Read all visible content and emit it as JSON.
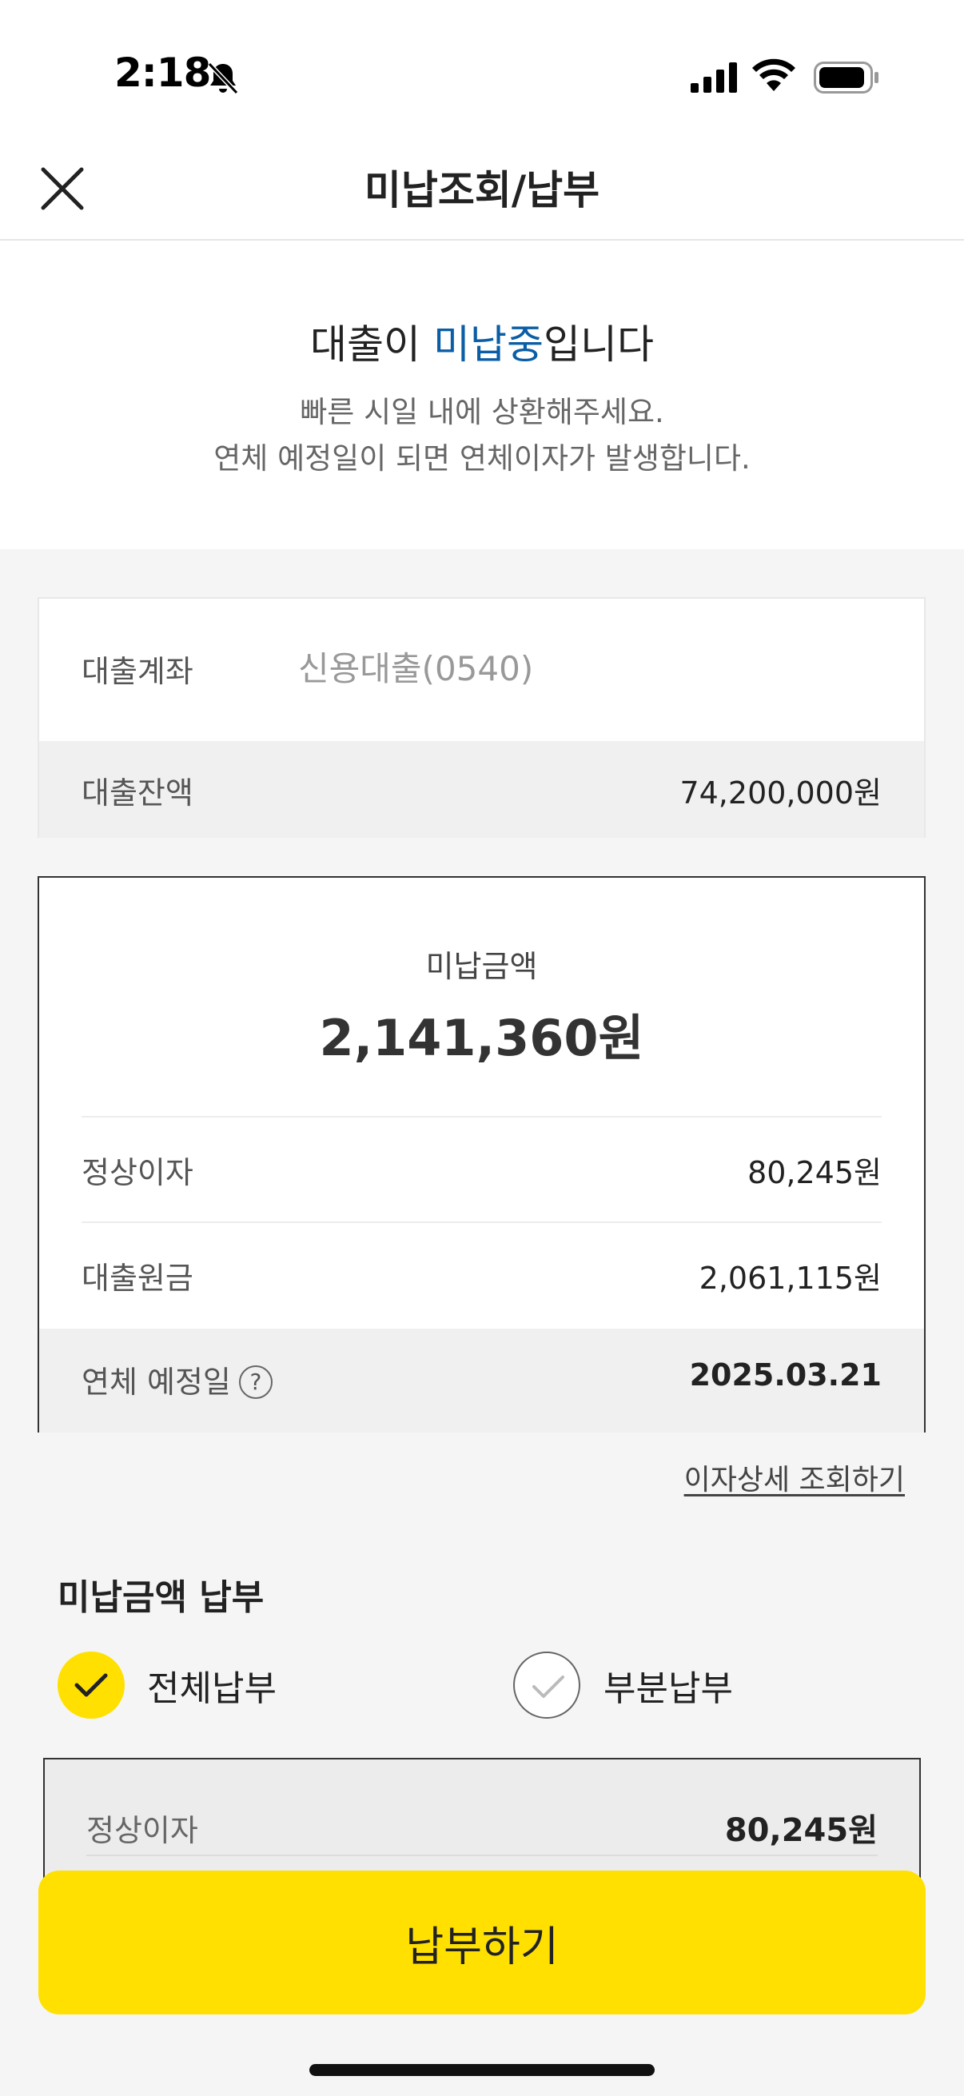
{
  "status_bar": {
    "time": "2:18"
  },
  "header": {
    "title": "미납조회/납부"
  },
  "notice": {
    "title_prefix": "대출이 ",
    "title_accent": "미납중",
    "title_suffix": "입니다",
    "desc_line1": "빠른 시일 내에 상환해주세요.",
    "desc_line2": "연체 예정일이 되면 연체이자가 발생합니다."
  },
  "loan": {
    "account_label": "대출계좌",
    "account_value": "신용대출(0540)",
    "balance_label": "대출잔액",
    "balance_value": "74,200,000원"
  },
  "unpaid": {
    "label": "미납금액",
    "amount": "2,141,360원",
    "interest_label": "정상이자",
    "interest_value": "80,245원",
    "principal_label": "대출원금",
    "principal_value": "2,061,115원",
    "due_label": "연체 예정일",
    "due_help": "?",
    "due_value": "2025.03.21"
  },
  "detail_link": "이자상세 조회하기",
  "payment": {
    "title": "미납금액 납부",
    "option_full": "전체납부",
    "option_partial": "부분납부",
    "selected": "전체납부",
    "breakdown_label": "정상이자",
    "breakdown_value": "80,245원"
  },
  "pay_button": "납부하기",
  "colors": {
    "accent_yellow": "#ffe000",
    "accent_blue": "#0a5ea6"
  }
}
